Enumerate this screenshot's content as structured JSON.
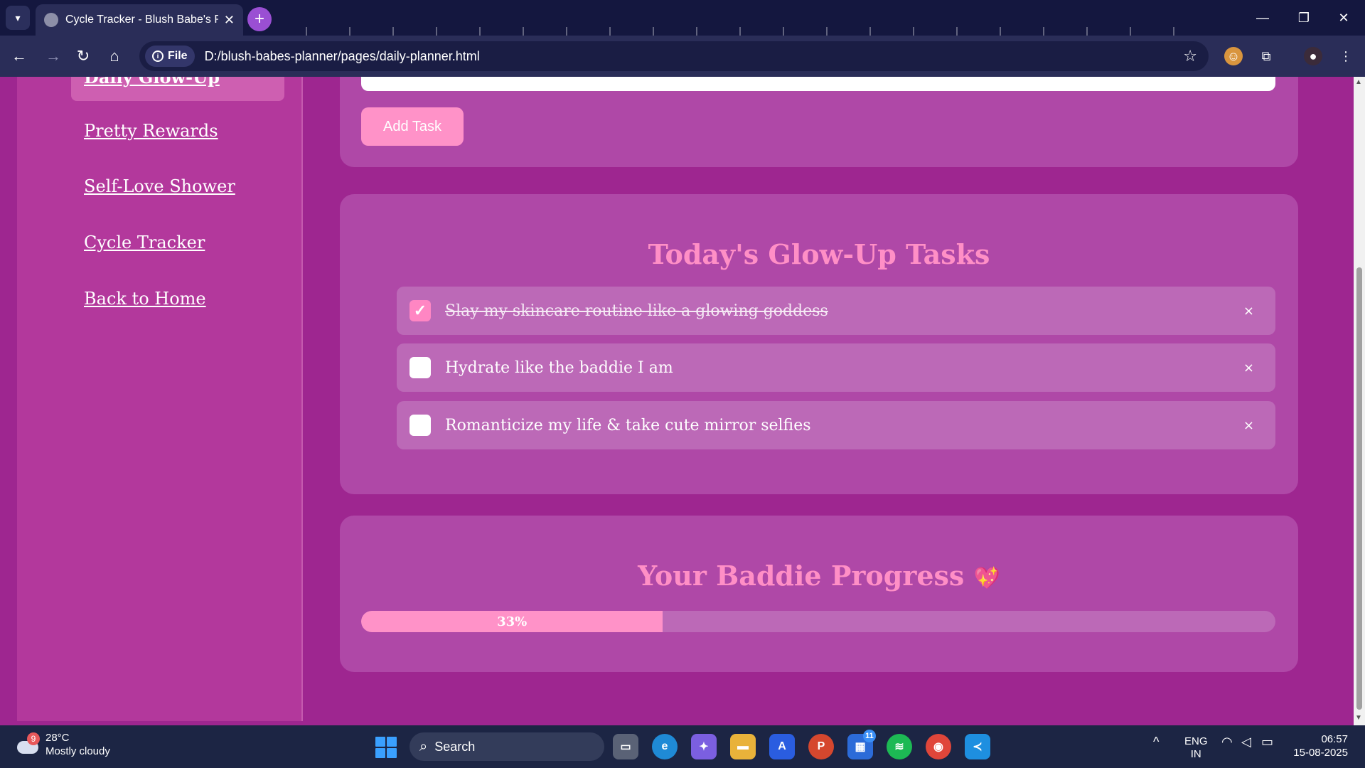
{
  "browser": {
    "tab_title": "Cycle Tracker - Blush Babe's Pin",
    "file_chip": "File",
    "url": "D:/blush-babes-planner/pages/daily-planner.html"
  },
  "sidebar": {
    "items": [
      {
        "label": "Daily Glow-Up",
        "active": true
      },
      {
        "label": "Pretty Rewards"
      },
      {
        "label": "Self-Love Shower"
      },
      {
        "label": "Cycle Tracker"
      },
      {
        "label": "Back to Home"
      }
    ]
  },
  "task_form": {
    "add_button": "Add Task"
  },
  "tasks_card": {
    "title": "Today's Glow-Up Tasks",
    "tasks": [
      {
        "text": "Slay my skincare routine like a glowing goddess",
        "done": true
      },
      {
        "text": "Hydrate like the baddie I am",
        "done": false
      },
      {
        "text": "Romanticize my life & take cute mirror selfies",
        "done": false
      }
    ],
    "check_mark": "✓",
    "delete_mark": "×"
  },
  "progress_card": {
    "title": "Your Baddie Progress",
    "heart": "💖",
    "value": 33,
    "label": "33%"
  },
  "taskbar": {
    "weather_badge": "9",
    "temperature": "28°C",
    "condition": "Mostly cloudy",
    "search_label": "Search",
    "teams_badge": "11",
    "language": "ENG",
    "region": "IN",
    "time": "06:57",
    "date": "15-08-2025"
  },
  "colors": {
    "page_bg": "#9e2690",
    "card_bg": "#af48a7",
    "accent_pink": "#ff92c8",
    "title_pink": "#ff8fc6"
  }
}
